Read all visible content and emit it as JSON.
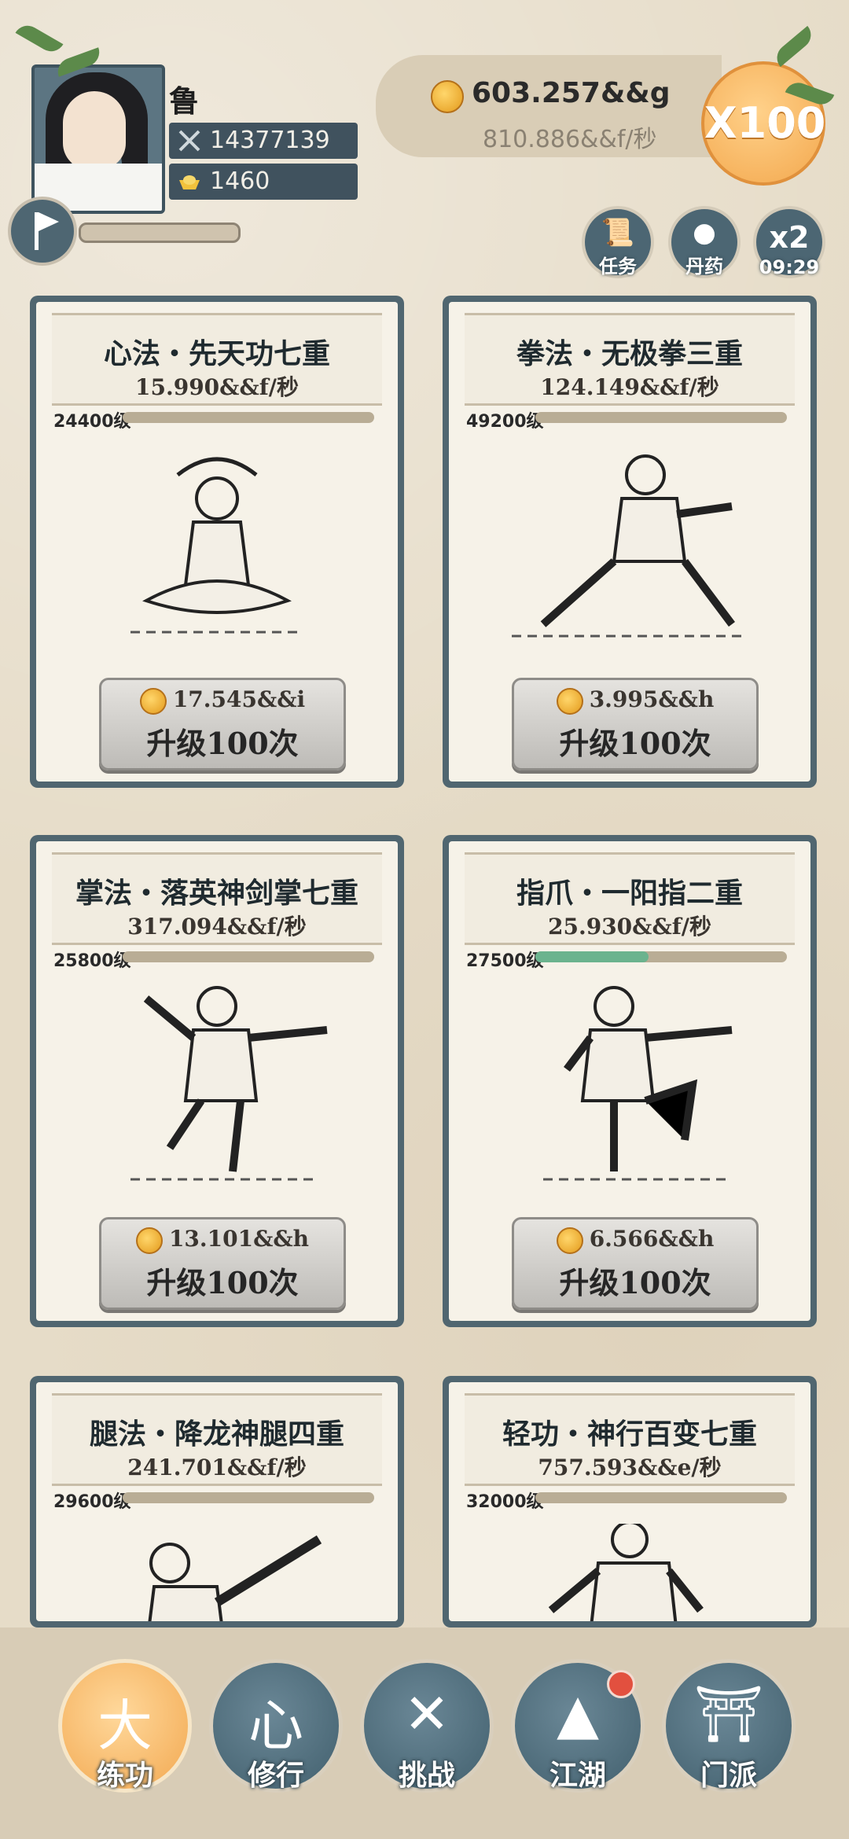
{
  "header": {
    "player_name": "鲁",
    "power": "14377139",
    "ingots": "1460",
    "gold_amount": "603.257&&g",
    "gold_rate": "810.886&&f/秒",
    "multiplier_label": "X100",
    "buttons": {
      "task": "任务",
      "pill": "丹药",
      "boost_label": "x2",
      "boost_timer": "09:29"
    }
  },
  "cards": [
    {
      "title": "心法・先天功七重",
      "rate": "15.990&&f/秒",
      "level": "24400级",
      "progress": 0.0,
      "cost": "17.545&&i",
      "action": "升级100次"
    },
    {
      "title": "拳法・无极拳三重",
      "rate": "124.149&&f/秒",
      "level": "49200级",
      "progress": 0.0,
      "cost": "3.995&&h",
      "action": "升级100次"
    },
    {
      "title": "掌法・落英神剑掌七重",
      "rate": "317.094&&f/秒",
      "level": "25800级",
      "progress": 0.0,
      "cost": "13.101&&h",
      "action": "升级100次"
    },
    {
      "title": "指爪・一阳指二重",
      "rate": "25.930&&f/秒",
      "level": "27500级",
      "progress": 0.45,
      "cost": "6.566&&h",
      "action": "升级100次"
    },
    {
      "title": "腿法・降龙神腿四重",
      "rate": "241.701&&f/秒",
      "level": "29600级",
      "progress": 0.0
    },
    {
      "title": "轻功・神行百变七重",
      "rate": "757.593&&e/秒",
      "level": "32000级",
      "progress": 0.0
    }
  ],
  "nav": [
    {
      "label": "练功",
      "icon": "martial-figure-icon",
      "active": true
    },
    {
      "label": "修行",
      "icon": "heart-calligraphy-icon",
      "active": false
    },
    {
      "label": "挑战",
      "icon": "crossed-swords-icon",
      "active": false
    },
    {
      "label": "江湖",
      "icon": "mountain-icon",
      "active": false,
      "badge": true
    },
    {
      "label": "门派",
      "icon": "gate-icon",
      "active": false
    }
  ]
}
